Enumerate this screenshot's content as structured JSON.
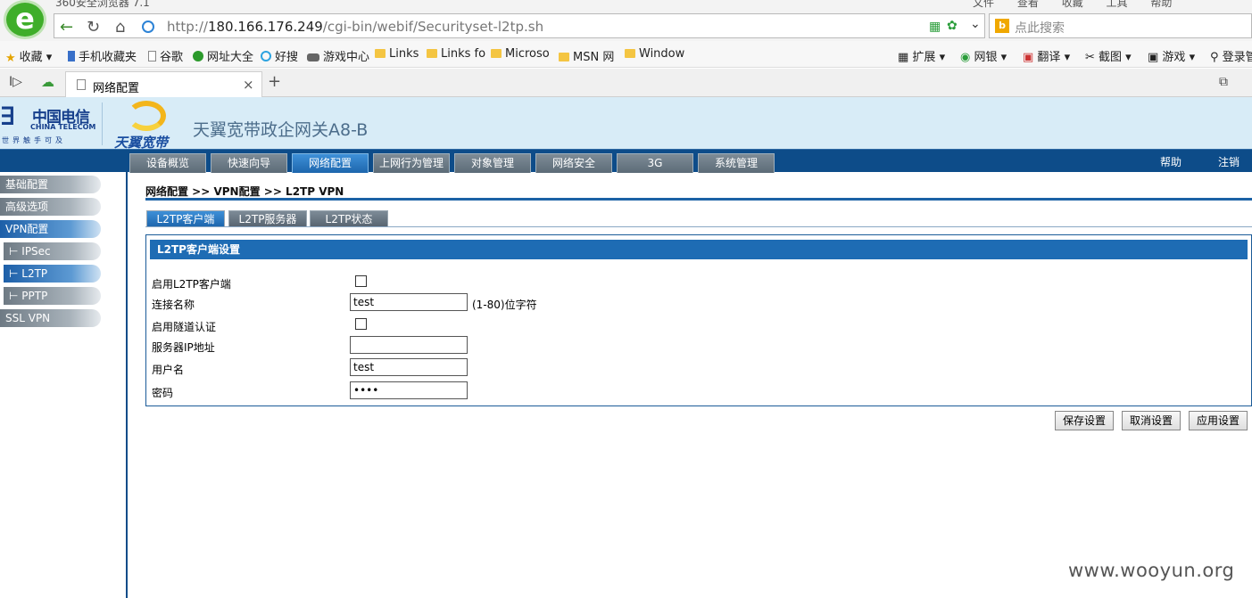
{
  "browser": {
    "title": "360安全浏览器 7.1",
    "menu": [
      "文件",
      "查看",
      "收藏",
      "工具",
      "帮助"
    ],
    "url_host": "180.166.176.249",
    "url_prefix": "http://",
    "url_path": "/cgi-bin/webif/Securityset-l2tp.sh",
    "search_placeholder": "点此搜索",
    "bookmarks": [
      {
        "label": "收藏",
        "icon": "star-icon"
      },
      {
        "label": "手机收藏夹",
        "icon": "phone-icon"
      },
      {
        "label": "谷歌",
        "icon": "doc-icon"
      },
      {
        "label": "网址大全",
        "icon": "globe-icon"
      },
      {
        "label": "好搜",
        "icon": "search-icon"
      },
      {
        "label": "游戏中心",
        "icon": "gamepad-icon"
      },
      {
        "label": "Links",
        "icon": "folder-icon"
      },
      {
        "label": "Links fo",
        "icon": "folder-icon"
      },
      {
        "label": "Microso",
        "icon": "folder-icon"
      },
      {
        "label": "MSN 网",
        "icon": "folder-icon"
      },
      {
        "label": "Window",
        "icon": "folder-icon"
      }
    ],
    "toolbar_right": [
      "扩展",
      "网银",
      "翻译",
      "截图",
      "游戏",
      "登录管"
    ],
    "tab_title": "网络配置"
  },
  "router": {
    "brand_cn": "中国电信",
    "brand_en": "CHINA TELECOM",
    "brand_slogan": "世界触手可及",
    "sub_brand": "天翼宽带",
    "product_title": "天翼宽带政企网关A8-B",
    "menu": [
      "设备概览",
      "快速向导",
      "网络配置",
      "上网行为管理",
      "对象管理",
      "网络安全",
      "3G",
      "系统管理"
    ],
    "menu_active": 2,
    "help": "帮助",
    "logout": "注销",
    "sidebar": [
      {
        "label": "基础配置",
        "sub": false,
        "active": false
      },
      {
        "label": "高级选项",
        "sub": false,
        "active": false
      },
      {
        "label": "VPN配置",
        "sub": false,
        "active": true
      },
      {
        "label": "IPSec",
        "sub": true,
        "active": false
      },
      {
        "label": "L2TP",
        "sub": true,
        "active": true
      },
      {
        "label": "PPTP",
        "sub": true,
        "active": false
      },
      {
        "label": "SSL VPN",
        "sub": false,
        "active": false
      }
    ],
    "breadcrumb": "网络配置 >> VPN配置 >> L2TP VPN",
    "subtabs": [
      "L2TP客户端",
      "L2TP服务器",
      "L2TP状态"
    ],
    "subtab_active": 0,
    "panel_title": "L2TP客户端设置",
    "fields": {
      "enable_label": "启用L2TP客户端",
      "enable_checked": false,
      "name_label": "连接名称",
      "name_value": "test",
      "name_hint": "(1-80)位字符",
      "tunnel_auth_label": "启用隧道认证",
      "tunnel_auth_checked": false,
      "server_ip_label": "服务器IP地址",
      "server_ip_value": "",
      "username_label": "用户名",
      "username_value": "test",
      "password_label": "密码",
      "password_value": "test"
    },
    "buttons": {
      "save": "保存设置",
      "cancel": "取消设置",
      "apply": "应用设置"
    }
  },
  "watermark": "www.wooyun.org"
}
